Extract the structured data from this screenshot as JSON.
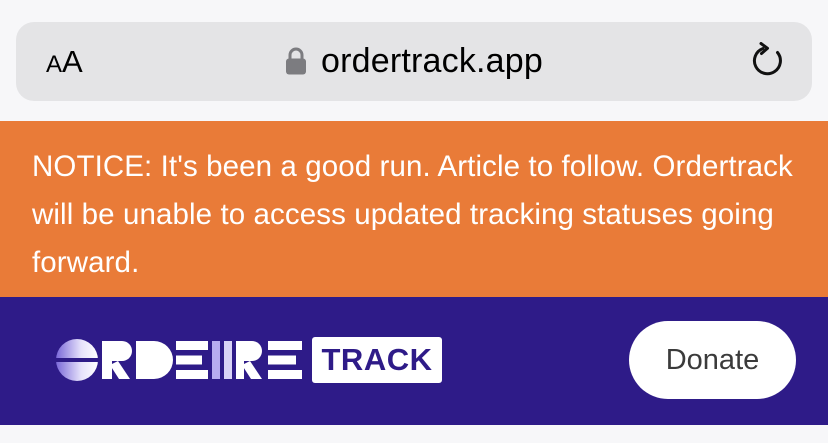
{
  "browser": {
    "text_size_small": "A",
    "text_size_large": "A",
    "url": "ordertrack.app",
    "lock_icon": "lock-icon",
    "reload_icon": "reload-icon"
  },
  "notice": {
    "text": "NOTICE: It's been a good run. Article to follow. Ordertrack will be unable to access updated tracking statuses going forward."
  },
  "brand": {
    "logo_text": "ORDER TRACK",
    "logo_track": "TRACK",
    "donate_label": "Donate"
  },
  "colors": {
    "notice_bg": "#e97b38",
    "brand_bg": "#2e1b88",
    "address_bar_bg": "#e4e4e6"
  }
}
